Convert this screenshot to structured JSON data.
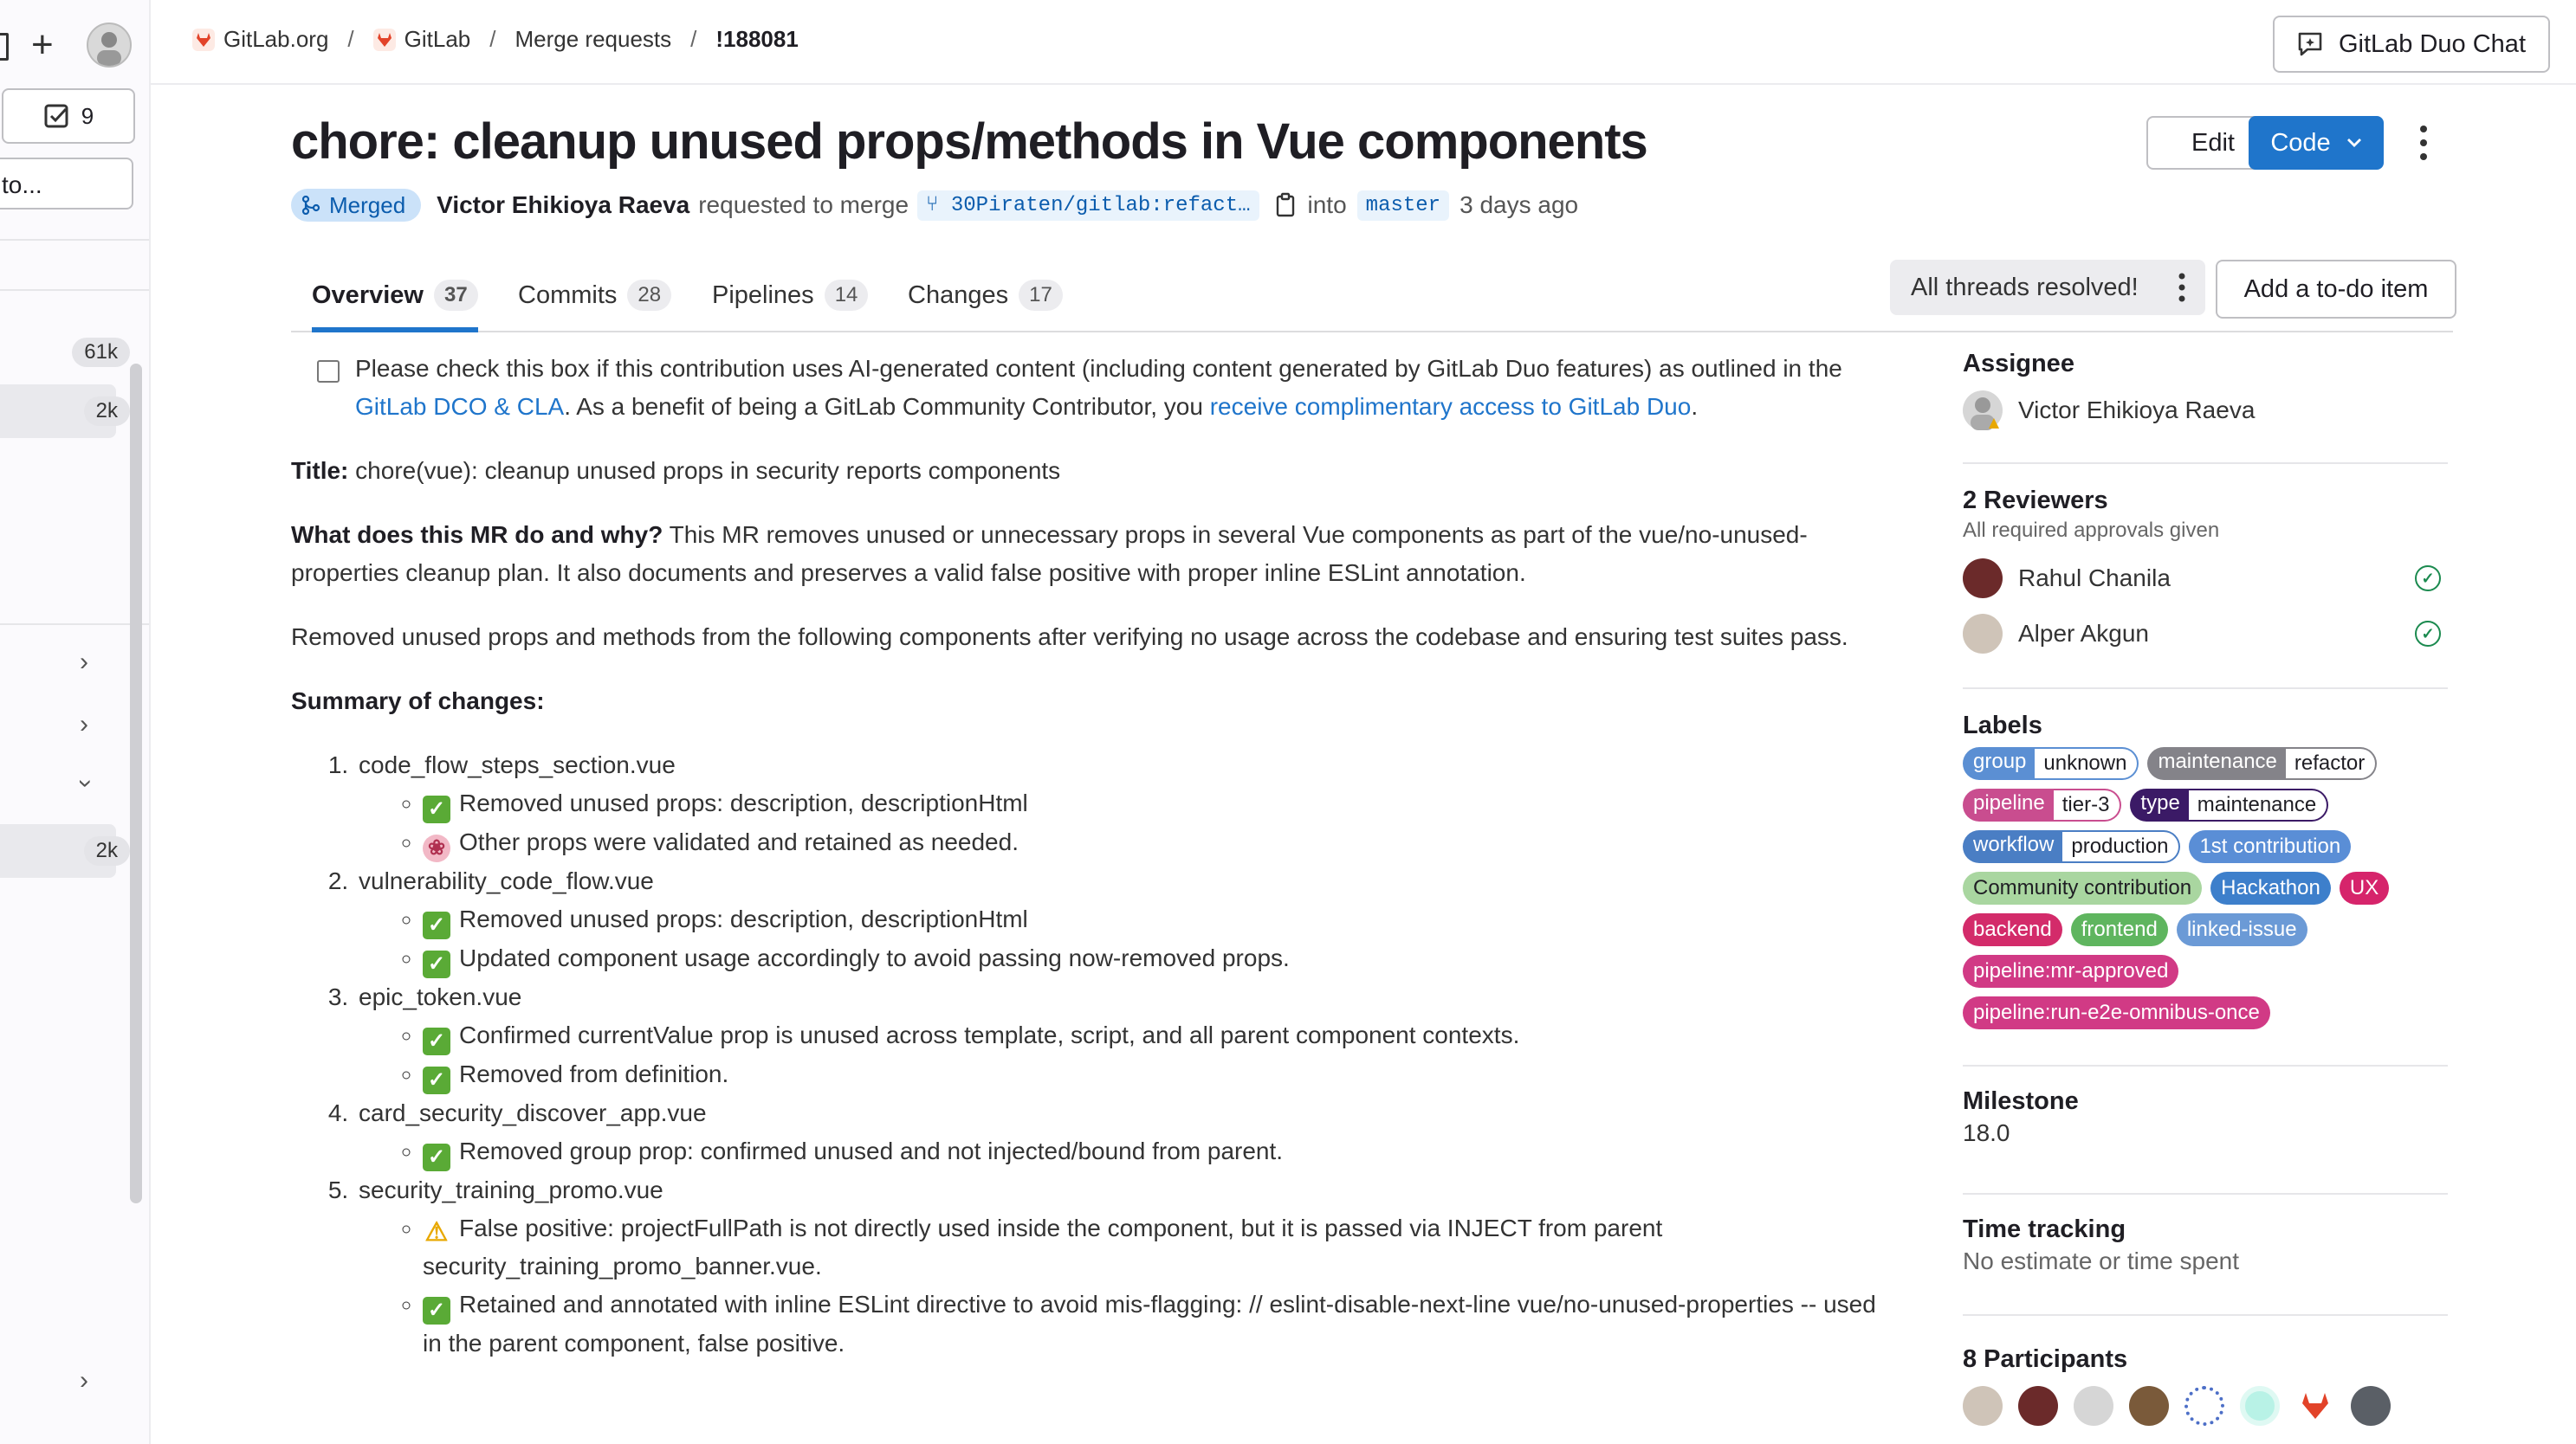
{
  "sidebar": {
    "todo_count": "9",
    "search_placeholder": "to...",
    "badges": [
      "61k",
      "2k",
      "2k"
    ]
  },
  "breadcrumb": {
    "items": [
      "GitLab.org",
      "GitLab",
      "Merge requests"
    ],
    "current": "!188081"
  },
  "topbar": {
    "duo_chat_label": "GitLab Duo Chat"
  },
  "mr": {
    "title": "chore: cleanup unused props/methods in Vue components",
    "edit_label": "Edit",
    "code_label": "Code",
    "status": "Merged",
    "author": "Victor Ehikioya Raeva",
    "requested_text": "requested to merge",
    "source_branch": "30Piraten/gitlab:refact…",
    "into_text": "into",
    "target_branch": "master",
    "time_ago": "3 days ago"
  },
  "tabs": [
    {
      "label": "Overview",
      "count": "37"
    },
    {
      "label": "Commits",
      "count": "28"
    },
    {
      "label": "Pipelines",
      "count": "14"
    },
    {
      "label": "Changes",
      "count": "17"
    }
  ],
  "threads_label": "All threads resolved!",
  "todo_button": "Add a to-do item",
  "description": {
    "checkbox_text_1": "Please check this box if this contribution uses AI-generated content (including content generated by GitLab Duo features) as outlined in the ",
    "checkbox_link_1": "GitLab DCO & CLA",
    "checkbox_text_2": ". As a benefit of being a GitLab Community Contributor, you ",
    "checkbox_link_2": "receive complimentary access to GitLab Duo",
    "checkbox_text_3": ".",
    "title_label": "Title:",
    "title_value": " chore(vue): cleanup unused props in security reports components",
    "what_label": "What does this MR do and why?",
    "what_value": " This MR removes unused or unnecessary props in several Vue components as part of the vue/no-unused-properties cleanup plan. It also documents and preserves a valid false positive with proper inline ESLint annotation.",
    "removed_para": "Removed unused props and methods from the following components after verifying no usage across the codebase and ensuring test suites pass.",
    "summary_label": "Summary of changes:",
    "items": [
      {
        "name": "code_flow_steps_section.vue",
        "sub": [
          {
            "icon": "check-mark-icon",
            "text": "Removed unused props: description, descriptionHtml"
          },
          {
            "icon": "brain-icon",
            "text": "Other props were validated and retained as needed."
          }
        ]
      },
      {
        "name": "vulnerability_code_flow.vue",
        "sub": [
          {
            "icon": "check-mark-icon",
            "text": "Removed unused props: description, descriptionHtml"
          },
          {
            "icon": "check-mark-icon",
            "text": "Updated component usage accordingly to avoid passing now-removed props."
          }
        ]
      },
      {
        "name": "epic_token.vue",
        "sub": [
          {
            "icon": "check-mark-icon",
            "text": "Confirmed currentValue prop is unused across template, script, and all parent component contexts."
          },
          {
            "icon": "check-mark-icon",
            "text": "Removed from definition."
          }
        ]
      },
      {
        "name": "card_security_discover_app.vue",
        "sub": [
          {
            "icon": "check-mark-icon",
            "text": "Removed group prop: confirmed unused and not injected/bound from parent."
          }
        ]
      },
      {
        "name": "security_training_promo.vue",
        "sub": [
          {
            "icon": "warning-icon",
            "text": "False positive: projectFullPath is not directly used inside the component, but it is passed via INJECT from parent security_training_promo_banner.vue."
          },
          {
            "icon": "check-mark-icon",
            "text": "Retained and annotated with inline ESLint directive to avoid mis-flagging: // eslint-disable-next-line vue/no-unused-properties -- used in the parent component, false positive."
          }
        ]
      }
    ]
  },
  "right_sidebar": {
    "assignee_heading": "Assignee",
    "assignee_name": "Victor Ehikioya Raeva",
    "reviewers_heading": "2 Reviewers",
    "reviewers_note": "All required approvals given",
    "reviewers": [
      "Rahul Chanila",
      "Alper Akgun"
    ],
    "labels_heading": "Labels",
    "labels": [
      {
        "key": "group",
        "value": "unknown",
        "color": "#5b8fd3"
      },
      {
        "key": "maintenance",
        "value": "refactor",
        "color": "#848389"
      },
      {
        "key": "pipeline",
        "value": "tier-3",
        "color": "#c94d8f"
      },
      {
        "key": "type",
        "value": "maintenance",
        "color": "#3b1a66"
      },
      {
        "key": "workflow",
        "value": "production",
        "color": "#4a7ec4"
      },
      {
        "text": "1st contribution",
        "color": "#5a8ed6"
      },
      {
        "text": "Community contribution",
        "color": "#a9d6a0",
        "dark": true
      },
      {
        "text": "Hackathon",
        "color": "#3d7fcb"
      },
      {
        "text": "UX",
        "color": "#d6246b"
      },
      {
        "text": "backend",
        "color": "#d32b6a"
      },
      {
        "text": "frontend",
        "color": "#5fb55f"
      },
      {
        "text": "linked-issue",
        "color": "#6b9ad6"
      },
      {
        "text": "pipeline:mr-approved",
        "color": "#d13a85"
      },
      {
        "text": "pipeline:run-e2e-omnibus-once",
        "color": "#d13a85"
      }
    ],
    "milestone_heading": "Milestone",
    "milestone_value": "18.0",
    "time_heading": "Time tracking",
    "time_value": "No estimate or time spent",
    "participants_heading": "8 Participants"
  },
  "colors": {
    "accent": "#1f75cb",
    "merged_bg": "#cbe2f9",
    "success": "#1b8a4f"
  }
}
